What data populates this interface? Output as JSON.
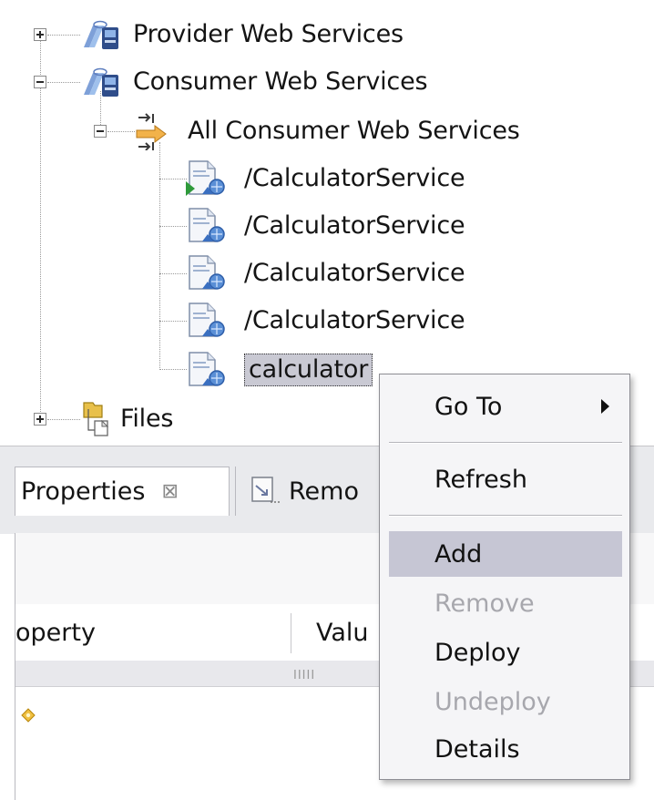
{
  "tree": {
    "provider_label": "Provider Web Services",
    "consumer_label": "Consumer Web Services",
    "all_consumer_label": "All Consumer Web Services",
    "services": [
      "/CalculatorService",
      "/CalculatorService",
      "/CalculatorService",
      "/CalculatorService"
    ],
    "selected_label": "calculator",
    "files_label": "Files"
  },
  "panel": {
    "properties_tab": "Properties",
    "close_glyph": "⊠",
    "remote_tab": "Remo",
    "col_property": "operty",
    "col_value": "Valu",
    "scroll_grip": "IIIII"
  },
  "context_menu": {
    "goto": "Go To",
    "refresh": "Refresh",
    "add": "Add",
    "remove": "Remove",
    "deploy": "Deploy",
    "undeploy": "Undeploy",
    "details": "Details"
  },
  "icons": {
    "provider": "web-services-icon",
    "consumer": "web-services-icon",
    "all_consumer": "arrow-transfer-icon",
    "service": "web-service-document-icon",
    "files": "files-folder-icon",
    "remote_tab": "remote-view-icon",
    "row": "property-marker-icon"
  },
  "colors": {
    "selection_highlight": "#c6c6d4",
    "disabled_text": "#a7a7ad",
    "tab_strip": "#e9eaed"
  }
}
